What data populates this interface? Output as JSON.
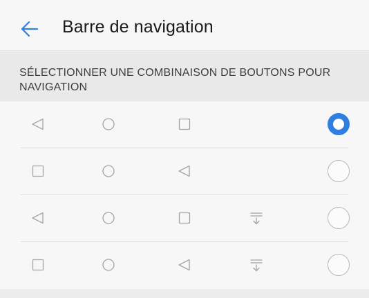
{
  "header": {
    "back_icon": "arrow-left-icon",
    "title": "Barre de navigation"
  },
  "section": {
    "title": "SÉLECTIONNER UNE COMBINAISON DE BOUTONS POUR NAVIGATION"
  },
  "colors": {
    "accent": "#2f7ee0",
    "icon_gray": "#a3a3a3",
    "background": "#f7f7f7",
    "section_background": "#e9e9e9"
  },
  "options": [
    {
      "buttons": [
        "back-triangle-icon",
        "home-circle-icon",
        "recent-square-icon"
      ],
      "selected": true
    },
    {
      "buttons": [
        "recent-square-icon",
        "home-circle-icon",
        "back-triangle-icon"
      ],
      "selected": false
    },
    {
      "buttons": [
        "back-triangle-icon",
        "home-circle-icon",
        "recent-square-icon",
        "notification-pull-down-icon"
      ],
      "selected": false
    },
    {
      "buttons": [
        "recent-square-icon",
        "home-circle-icon",
        "back-triangle-icon",
        "notification-pull-down-icon"
      ],
      "selected": false
    }
  ]
}
